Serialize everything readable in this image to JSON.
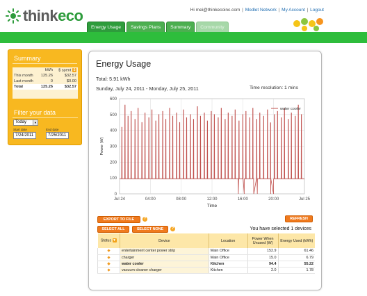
{
  "header": {
    "logo_think": "think",
    "logo_eco": "eco",
    "greeting": "Hi mei@thinkecoinc.com",
    "links": [
      "Modlet Network",
      "My Account",
      "Logout"
    ]
  },
  "tabs": [
    {
      "label": "Energy Usage",
      "state": "active"
    },
    {
      "label": "Savings Plans",
      "state": "normal"
    },
    {
      "label": "Summary",
      "state": "normal"
    },
    {
      "label": "Community",
      "state": "disabled"
    }
  ],
  "sidebar": {
    "summary_title": "Summary",
    "col_kwh": "kWh",
    "col_spent": "$ spent",
    "rows": [
      {
        "label": "This month",
        "kwh": "125.26",
        "spent": "$32.57"
      },
      {
        "label": "Last month",
        "kwh": "0",
        "spent": "$0.00"
      },
      {
        "label": "Total",
        "kwh": "125.26",
        "spent": "$32.57"
      }
    ],
    "filter_title": "Filter your data",
    "period": "Today",
    "start_label": "Start date",
    "end_label": "End date",
    "start_date": "7/24/2011",
    "end_date": "7/25/2011"
  },
  "main": {
    "title": "Energy Usage",
    "total": "Total: 5.91 kWh",
    "range": "Sunday, July 24, 2011 - Monday, July 25, 2011",
    "resolution": "Time resolution: 1 mins",
    "export_label": "EXPORT TO FILE",
    "select_all_label": "SELECT ALL",
    "select_none_label": "SELECT NONE",
    "refresh_label": "REFRESH",
    "selected_text": "You have selected 1 devices",
    "help_glyph": "?",
    "status_glyph": "◆"
  },
  "table": {
    "headers": [
      "Status",
      "Device",
      "Location",
      "Power When Unused (W)",
      "Energy Used (kWh)"
    ],
    "rows": [
      {
        "device": "entertainment center power strip",
        "location": "Main Office",
        "power": "152.9",
        "energy": "61.46",
        "highlight": false
      },
      {
        "device": "charger",
        "location": "Main Office",
        "power": "15.0",
        "energy": "6.79",
        "highlight": false
      },
      {
        "device": "water cooler",
        "location": "Kitchen",
        "power": "94.4",
        "energy": "55.22",
        "highlight": true
      },
      {
        "device": "vacuum cleaner charger",
        "location": "Kitchen",
        "power": "2.0",
        "energy": "1.78",
        "highlight": false
      }
    ]
  },
  "chart_data": {
    "type": "line",
    "title": "",
    "xlabel": "Time",
    "ylabel": "Power (W)",
    "ylim": [
      0,
      600
    ],
    "yticks": [
      0,
      100,
      200,
      300,
      400,
      500,
      600
    ],
    "xticks": [
      "Jul 24",
      "04:00",
      "08:00",
      "12:00",
      "16:00",
      "20:00",
      "Jul 25"
    ],
    "xlim_hours": [
      0,
      24
    ],
    "grid": true,
    "legend": "top-right",
    "series": [
      {
        "name": "water cooler",
        "color": "#c0504d",
        "baseline_w": 95,
        "spike_hours": [
          0.3,
          0.7,
          1.1,
          1.5,
          2.0,
          2.4,
          2.9,
          3.3,
          3.8,
          4.2,
          4.7,
          5.1,
          5.6,
          6.0,
          6.5,
          6.9,
          7.4,
          7.8,
          8.3,
          8.7,
          9.2,
          9.6,
          10.1,
          10.5,
          11.0,
          11.4,
          11.9,
          12.3,
          12.8,
          13.2,
          13.7,
          14.1,
          14.6,
          15.0,
          15.5,
          16.0,
          16.4,
          16.9,
          17.3,
          17.8,
          18.2,
          18.7,
          19.2,
          19.6,
          20.1,
          20.5,
          21.0,
          21.4,
          21.9,
          22.3,
          22.8,
          23.2,
          23.6
        ],
        "spike_values": [
          420,
          560,
          490,
          520,
          470,
          540,
          450,
          510,
          480,
          530,
          460,
          500,
          520,
          470,
          540,
          490,
          510,
          450,
          530,
          480,
          500,
          470,
          550,
          490,
          510,
          460,
          520,
          500,
          480,
          540,
          470,
          510,
          490,
          530,
          460,
          500,
          520,
          480,
          540,
          470,
          510,
          490,
          530,
          450,
          500,
          520,
          480,
          540,
          470,
          510,
          490,
          560,
          500
        ],
        "dropouts_hours": [
          [
            15.4,
            16.2
          ],
          [
            17.4,
            17.9
          ],
          [
            19.6,
            20.0
          ]
        ]
      }
    ]
  }
}
